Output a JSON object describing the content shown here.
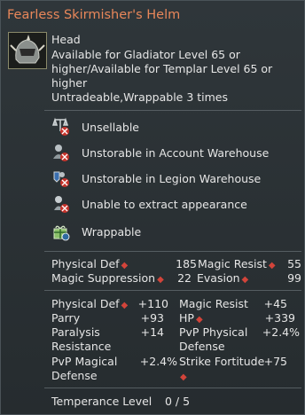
{
  "title": "Fearless Skirmisher's Helm",
  "item": {
    "slot": "Head",
    "requirement_line1": "Available for Gladiator Level 65 or",
    "requirement_line2": "higher/Available for Templar Level 65 or",
    "requirement_line3": "higher",
    "trade_info": "Untradeable,Wrappable 3 times"
  },
  "flags": [
    {
      "icon": "scale-unsellable-icon",
      "label": "Unsellable"
    },
    {
      "icon": "account-warehouse-blocked-icon",
      "label": "Unstorable in Account Warehouse"
    },
    {
      "icon": "legion-warehouse-blocked-icon",
      "label": "Unstorable in Legion Warehouse"
    },
    {
      "icon": "extract-appearance-blocked-icon",
      "label": "Unable to extract appearance"
    },
    {
      "icon": "wrap-box-icon",
      "label": "Wrappable"
    }
  ],
  "base_stats": [
    {
      "label": "Physical Def",
      "value": "185"
    },
    {
      "label": "Magic Resist",
      "value": "55"
    },
    {
      "label": "Magic Suppression",
      "value": "22"
    },
    {
      "label": "Evasion",
      "value": "99"
    }
  ],
  "bonus_stats": {
    "physical_def": {
      "label": "Physical Def",
      "value": "+110"
    },
    "magic_resist": {
      "label": "Magic Resist",
      "value": "+45"
    },
    "parry": {
      "label": "Parry",
      "value": "+93"
    },
    "hp": {
      "label": "HP",
      "value": "+339"
    },
    "paralysis_resistance_1": "Paralysis",
    "paralysis_resistance_2": "Resistance",
    "paralysis_value": "+14",
    "pvp_physical_defense_1": "PvP Physical",
    "pvp_physical_defense_2": "Defense",
    "pvp_physical_value": "+2.4%",
    "pvp_magical_defense_1": "PvP Magical",
    "pvp_magical_defense_2": "Defense",
    "pvp_magical_value": "+2.4%",
    "strike_fortitude": {
      "label": "Strike Fortitude",
      "value": "+75"
    }
  },
  "temperance": {
    "label": "Temperance Level",
    "value": "0 / 5"
  },
  "colors": {
    "title": "#e8875a",
    "diamond": "#d2443a",
    "background": "#2b3236"
  }
}
